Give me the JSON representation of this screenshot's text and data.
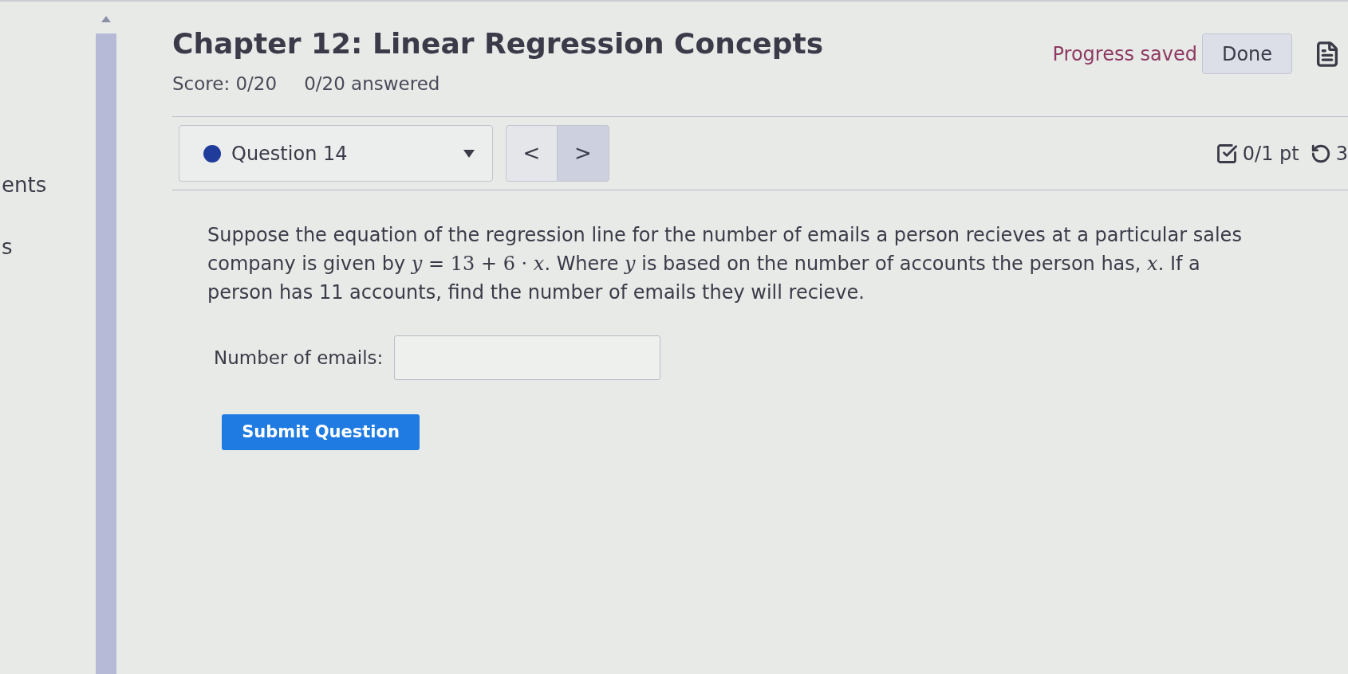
{
  "sidebar": {
    "items": [
      "ents",
      "s"
    ]
  },
  "header": {
    "title": "Chapter 12: Linear Regression Concepts",
    "score": "Score: 0/20",
    "answered": "0/20 answered",
    "status": "Progress saved",
    "done_button": "Done"
  },
  "question_bar": {
    "question_select": {
      "label": "Question 14"
    },
    "nav": [
      {
        "label": "<",
        "highlighted": false
      },
      {
        "label": ">",
        "highlighted": true
      }
    ],
    "points": "0/1 pt",
    "attempts": "3"
  },
  "question": {
    "segments": [
      {
        "kind": "text",
        "text": "Suppose the equation of the regression line for the number of emails a person recieves at a particular sales company is given by "
      },
      {
        "kind": "math",
        "text": "*y* = 13 + 6 · *x*"
      },
      {
        "kind": "text",
        "text": ". Where "
      },
      {
        "kind": "math",
        "text": "*y*"
      },
      {
        "kind": "text",
        "text": " is based on the number of accounts the person has, "
      },
      {
        "kind": "math",
        "text": "*x*"
      },
      {
        "kind": "text",
        "text": ". If a person has 11 accounts, find the number of emails they will recieve."
      }
    ],
    "answer": {
      "label": "Number of emails:"
    },
    "submit_button": "Submit Question"
  }
}
